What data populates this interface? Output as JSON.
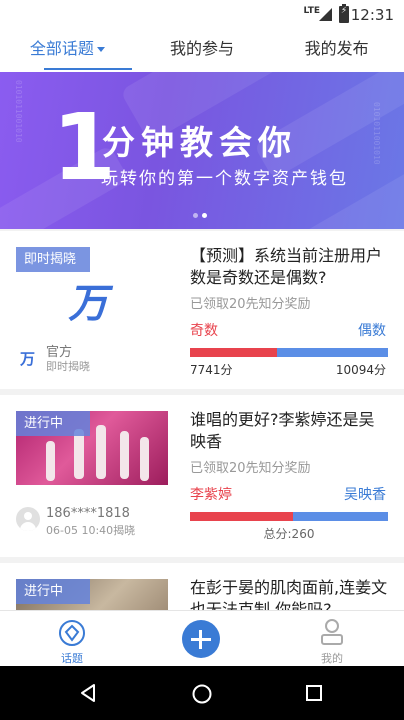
{
  "status_bar": {
    "network": "LTE",
    "time": "12:31"
  },
  "tabs": [
    {
      "label": "全部话题"
    },
    {
      "label": "我的参与"
    },
    {
      "label": "我的发布"
    }
  ],
  "banner": {
    "big_number": "1",
    "title": "分钟教会你",
    "subtitle": "玩转你的第一个数字资产钱包",
    "binary_text": "0101011001010"
  },
  "topics": [
    {
      "tag": "即时揭晓",
      "logo_char": "万",
      "question": "【预测】系统当前注册用户数是奇数还是偶数?",
      "reward": "已领取20先知分奖励",
      "option_a": "奇数",
      "option_b": "偶数",
      "ratio_a": 0.44,
      "score_a": "7741分",
      "score_b": "10094分",
      "author": "官方",
      "author_sub": "即时揭晓"
    },
    {
      "tag": "进行中",
      "question": "谁唱的更好?李紫婷还是吴映香",
      "reward": "已领取20先知分奖励",
      "option_a": "李紫婷",
      "option_b": "吴映香",
      "ratio_a": 0.52,
      "total": "总分:260",
      "author": "186****1818",
      "author_sub": "06-05 10:40揭晓"
    },
    {
      "tag": "进行中",
      "question": "在彭于晏的肌肉面前,连姜文也无法克制,你能吗?"
    }
  ],
  "bottom_nav": [
    {
      "label": "话题"
    },
    {
      "label": "我的"
    }
  ],
  "colors": {
    "accent": "#3a7bd5",
    "red": "#e8434d",
    "blue_bar": "#5b8ee6"
  }
}
